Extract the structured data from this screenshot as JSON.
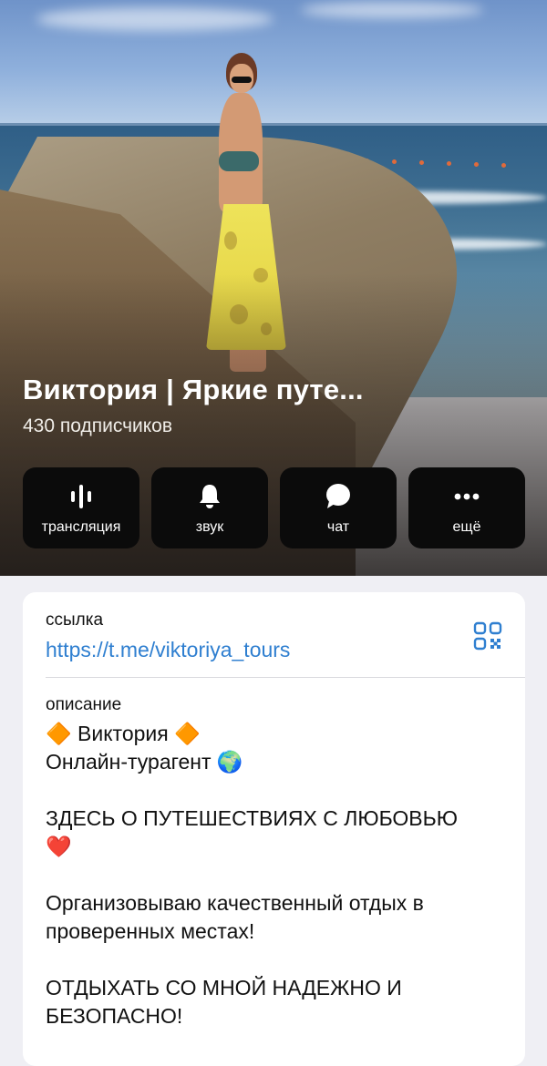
{
  "channel": {
    "title": "Виктория | Яркие путе...",
    "subscribers": "430 подписчиков"
  },
  "actions": [
    {
      "label": "трансляция",
      "icon": "broadcast-icon"
    },
    {
      "label": "звук",
      "icon": "bell-icon"
    },
    {
      "label": "чат",
      "icon": "chat-bubble-icon"
    },
    {
      "label": "ещё",
      "icon": "more-dots-icon"
    }
  ],
  "info": {
    "link_label": "ссылка",
    "link_value": "https://t.me/viktoriya_tours",
    "description_label": "описание",
    "description_lines": [
      "🔶 Виктория 🔶",
      "Онлайн-турагент 🌍",
      "",
      "ЗДЕСЬ О ПУТЕШЕСТВИЯХ С ЛЮБОВЬЮ",
      "❤️",
      "",
      "Организовываю качественный отдых в",
      "проверенных местах!",
      "",
      "ОТДЫХАТЬ СО МНОЙ НАДЕЖНО И",
      "БЕЗОПАСНО!"
    ]
  },
  "colors": {
    "link": "#2f7fd0",
    "button_bg": "#0b0b0b",
    "page_bg": "#efeff4"
  }
}
